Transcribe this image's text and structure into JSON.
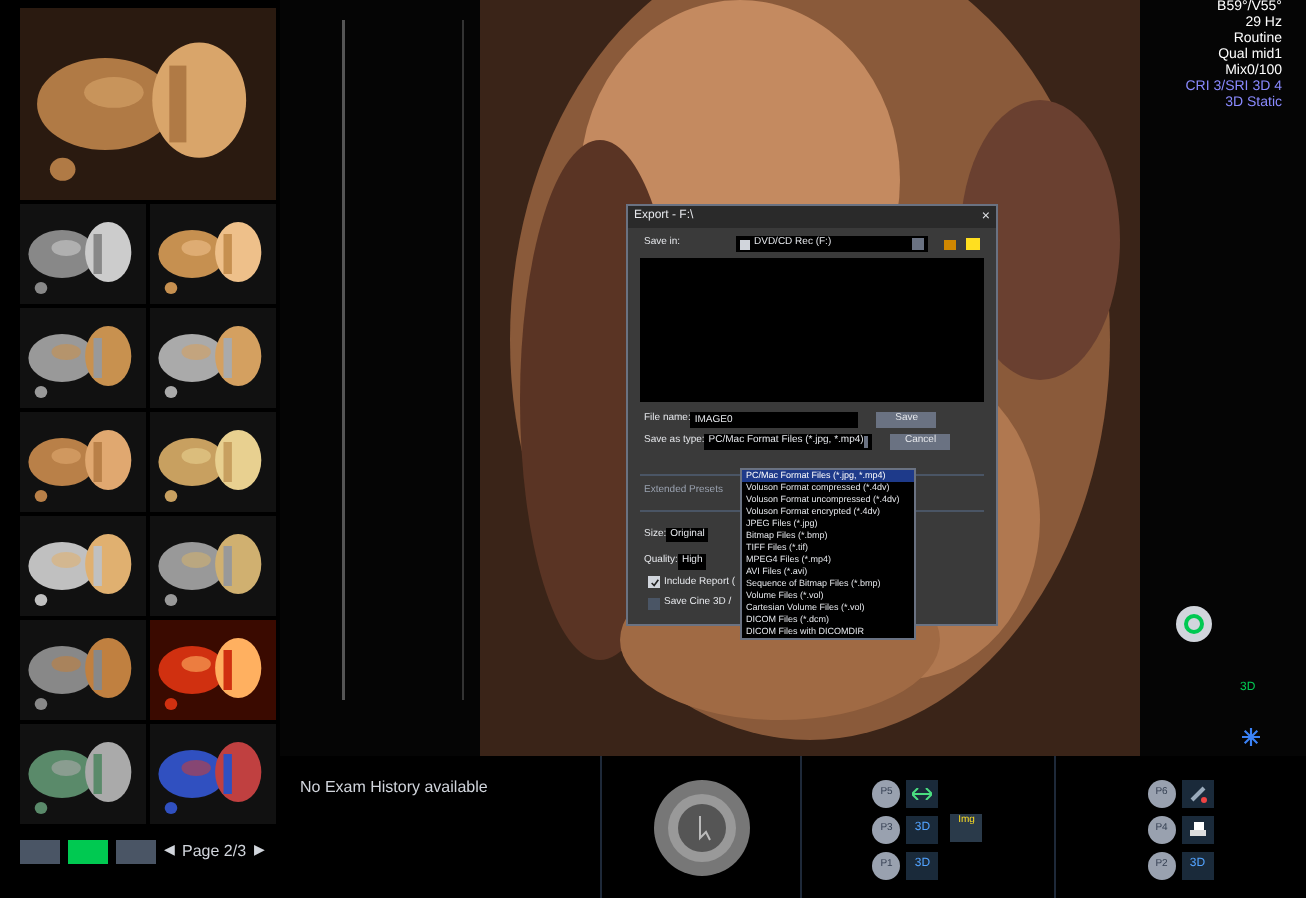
{
  "pager": {
    "views": [
      {
        "selected": false
      },
      {
        "selected": true
      },
      {
        "selected": false
      }
    ],
    "prev": "◀",
    "label": "Page 2/3",
    "next": "▶"
  },
  "info": [
    {
      "text": "B59°/V55°",
      "highlight": false
    },
    {
      "text": "29 Hz",
      "highlight": false
    },
    {
      "text": "Routine",
      "highlight": false
    },
    {
      "text": "Qual mid1",
      "highlight": false
    },
    {
      "text": "Mix0/100",
      "highlight": false
    },
    {
      "text": "CRI 3/SRI 3D 4",
      "highlight": true
    },
    {
      "text": "3D Static",
      "highlight": true
    }
  ],
  "side_label": "3D",
  "exam_history": "No Exam History available",
  "key_groups": [
    {
      "keys": [
        {
          "label": "P5",
          "kind": "arrows"
        },
        {
          "label": "P3",
          "kind": "text",
          "text": "3D"
        },
        {
          "label": "P1",
          "kind": "text",
          "text": "3D"
        }
      ],
      "extra": "Img"
    },
    {
      "keys": [
        {
          "label": "P6",
          "kind": "pen"
        },
        {
          "label": "P4",
          "kind": "printer"
        },
        {
          "label": "P2",
          "kind": "text",
          "text": "3D"
        }
      ]
    }
  ],
  "export_dialog": {
    "title": "Export - F:\\",
    "close": "×",
    "save_in_label": "Save in:",
    "save_in": "DVD/CD Rec (F:)",
    "file_name_label": "File name:",
    "file_name": "IMAGE0",
    "save": "Save",
    "cancel": "Cancel",
    "type_label": "Save as type:",
    "type": "PC/Mac Format Files (*.jpg, *.mp4)",
    "type_options": [
      {
        "label": "PC/Mac Format Files (*.jpg, *.mp4)",
        "selected": true
      },
      {
        "label": "Voluson Format compressed (*.4dv)",
        "selected": false
      },
      {
        "label": "Voluson Format uncompressed (*.4dv)",
        "selected": false
      },
      {
        "label": "Voluson Format encrypted (*.4dv)",
        "selected": false
      },
      {
        "label": "JPEG Files (*.jpg)",
        "selected": false
      },
      {
        "label": "Bitmap Files (*.bmp)",
        "selected": false
      },
      {
        "label": "TIFF Files (*.tif)",
        "selected": false
      },
      {
        "label": "MPEG4 Files (*.mp4)",
        "selected": false
      },
      {
        "label": "AVI Files (*.avi)",
        "selected": false
      },
      {
        "label": "Sequence of Bitmap Files (*.bmp)",
        "selected": false
      },
      {
        "label": "Volume Files (*.vol)",
        "selected": false
      },
      {
        "label": "Cartesian Volume Files (*.vol)",
        "selected": false
      },
      {
        "label": "DICOM Files (*.dcm)",
        "selected": false
      },
      {
        "label": "DICOM Files with DICOMDIR",
        "selected": false
      }
    ],
    "extended": "Extended Presets",
    "size_label": "Size:",
    "size": "Original",
    "quality_label": "Quality:",
    "quality": "High",
    "options": [
      {
        "label": "Include Report (",
        "checked": true
      },
      {
        "label": "Save Cine 3D /",
        "checked": false
      }
    ]
  }
}
